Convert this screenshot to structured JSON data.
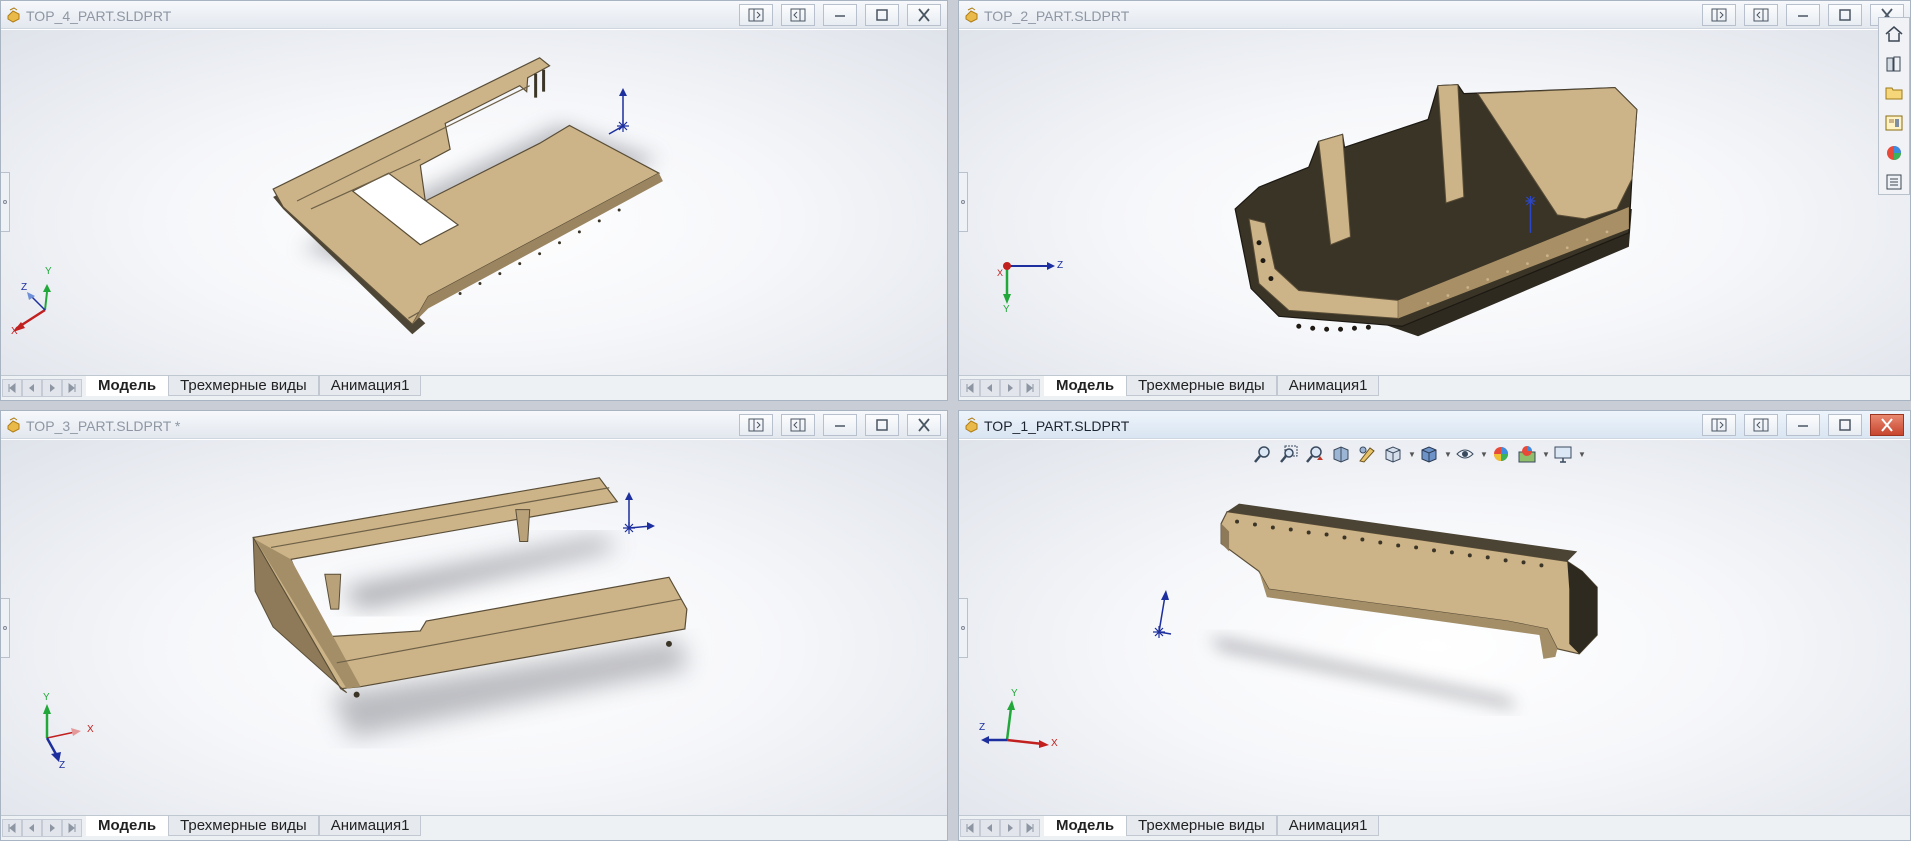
{
  "windows": {
    "top_left": {
      "title": "TOP_4_PART.SLDPRT"
    },
    "top_right": {
      "title": "TOP_2_PART.SLDPRT"
    },
    "bottom_left": {
      "title": "TOP_3_PART.SLDPRT *"
    },
    "bottom_right": {
      "title": "TOP_1_PART.SLDPRT"
    }
  },
  "tabs": [
    "Модель",
    "Трехмерные виды",
    "Анимация1"
  ],
  "axis_labels": {
    "x": "X",
    "y": "Y",
    "z": "Z"
  },
  "colors": {
    "model_fill": "#cdb488",
    "model_shade": "#3b3527",
    "axis_x": "#c21f1f",
    "axis_y": "#22a83a",
    "axis_z": "#1d2f9e"
  },
  "icons": {
    "title_buttons": [
      "tile-horizontal-icon",
      "tile-vertical-icon",
      "minimize-icon",
      "maximize-icon",
      "close-icon"
    ],
    "heads_up": [
      "zoom-to-fit-icon",
      "zoom-area-icon",
      "previous-view-icon",
      "section-view-icon",
      "dynamic-annotation-icon",
      "view-orientation-icon",
      "display-style-icon",
      "hide-show-icon",
      "edit-appearance-icon",
      "apply-scene-icon",
      "view-settings-icon"
    ],
    "task_pane": [
      "home-icon",
      "design-library-icon",
      "file-explorer-icon",
      "view-palette-icon",
      "appearances-icon",
      "custom-properties-icon"
    ]
  }
}
